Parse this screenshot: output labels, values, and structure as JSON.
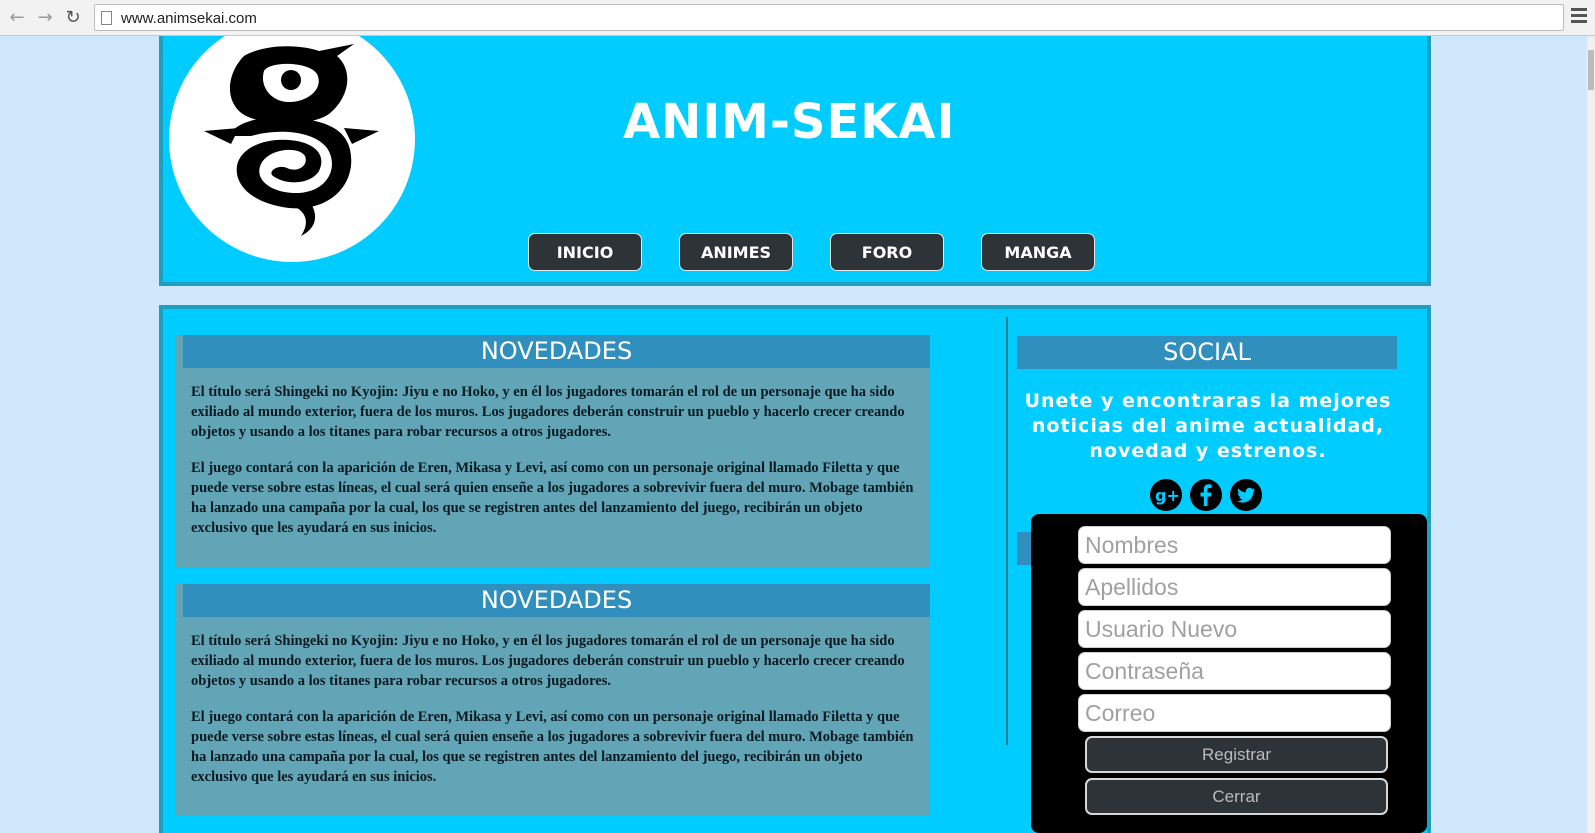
{
  "browser": {
    "url": "www.animsekai.com",
    "back_icon": "back-arrow-icon",
    "forward_icon": "forward-arrow-icon",
    "reload_icon": "reload-icon",
    "menu_icon": "hamburger-menu-icon"
  },
  "header": {
    "title": "ANIM-SEKAI",
    "nav": [
      "INICIO",
      "ANIMES",
      "FORO",
      "MANGA"
    ]
  },
  "news": [
    {
      "title": "NOVEDADES",
      "paragraphs": [
        "El título será Shingeki no Kyojin: Jiyu e no Hoko, y en él los jugadores tomarán el rol de un personaje que ha sido exiliado al mundo exterior, fuera de los muros. Los jugadores deberán construir un pueblo y hacerlo crecer creando objetos y usando a los titanes para robar recursos a otros jugadores.",
        "El juego contará con la aparición de Eren, Mikasa y Levi, así como con un personaje original llamado Filetta y que puede verse sobre estas líneas, el cual será quien enseñe a los jugadores a sobrevivir fuera del muro. Mobage también ha lanzado una campaña por la cual, los que se registren antes del lanzamiento del juego, recibirán un objeto exclusivo que les ayudará en sus inicios."
      ]
    },
    {
      "title": "NOVEDADES",
      "paragraphs": [
        "El título será Shingeki no Kyojin: Jiyu e no Hoko, y en él los jugadores tomarán el rol de un personaje que ha sido exiliado al mundo exterior, fuera de los muros. Los jugadores deberán construir un pueblo y hacerlo crecer creando objetos y usando a los titanes para robar recursos a otros jugadores.",
        "El juego contará con la aparición de Eren, Mikasa y Levi, así como con un personaje original llamado Filetta y que puede verse sobre estas líneas, el cual será quien enseñe a los jugadores a sobrevivir fuera del muro. Mobage también ha lanzado una campaña por la cual, los que se registren antes del lanzamiento del juego, recibirán un objeto exclusivo que les ayudará en sus inicios."
      ]
    }
  ],
  "social": {
    "title": "SOCIAL",
    "text": "Unete y encontraras la mejores noticias del anime actualidad, novedad y estrenos.",
    "icons": [
      "google-plus-icon",
      "facebook-icon",
      "twitter-icon"
    ]
  },
  "register": {
    "fields": [
      {
        "placeholder": "Nombres"
      },
      {
        "placeholder": "Apellidos"
      },
      {
        "placeholder": "Usuario Nuevo"
      },
      {
        "placeholder": "Contraseña"
      },
      {
        "placeholder": "Correo"
      }
    ],
    "submit_label": "Registrar",
    "close_label": "Cerrar"
  },
  "colors": {
    "page_bg": "#cfe8fb",
    "header_bg": "#00ccff",
    "section_head": "#318fbe",
    "news_bg": "#62a5b6",
    "nav_button": "#2e3338"
  }
}
